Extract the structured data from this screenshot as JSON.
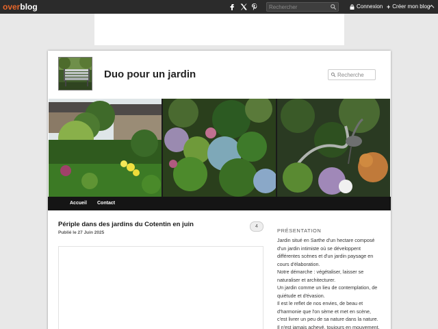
{
  "topbar": {
    "logo_part1": "over",
    "logo_part2": "blog",
    "social_icons": [
      "facebook-icon",
      "x-icon",
      "pinterest-icon"
    ],
    "search_placeholder": "Rechercher",
    "connexion_label": "Connexion",
    "create_blog_label": "Créer mon blog",
    "colors": {
      "bar": "#2b2b2b",
      "logo_accent": "#e8662a"
    }
  },
  "blog": {
    "title": "Duo pour un jardin",
    "search_placeholder": "Recherche"
  },
  "nav": {
    "items": [
      "Accueil",
      "Contact"
    ]
  },
  "post": {
    "title": "Périple dans des jardins du Cotentin en juin",
    "date": "Publié le 27 Juin 2025",
    "comment_count": "4"
  },
  "sidebar": {
    "widget_title": "PRÉSENTATION",
    "lines": [
      "Jardin situé en Sarthe d'un hectare composé d'un jardin intimiste où se développent différentes scènes et d'un jardin paysage en cours d'élaboration.",
      "Notre démarche : végétaliser, laisser se naturaliser et architecturer.",
      "Un jardin comme un lieu de contemplation, de quiétude et d'évasion.",
      "Il est le reflet de nos envies, de beau et d'harmonie que l'on sème et met en scène, c'est livrer un peu de sa nature dans la nature.",
      "Il n'est jamais achevé, toujours en mouvement."
    ]
  }
}
